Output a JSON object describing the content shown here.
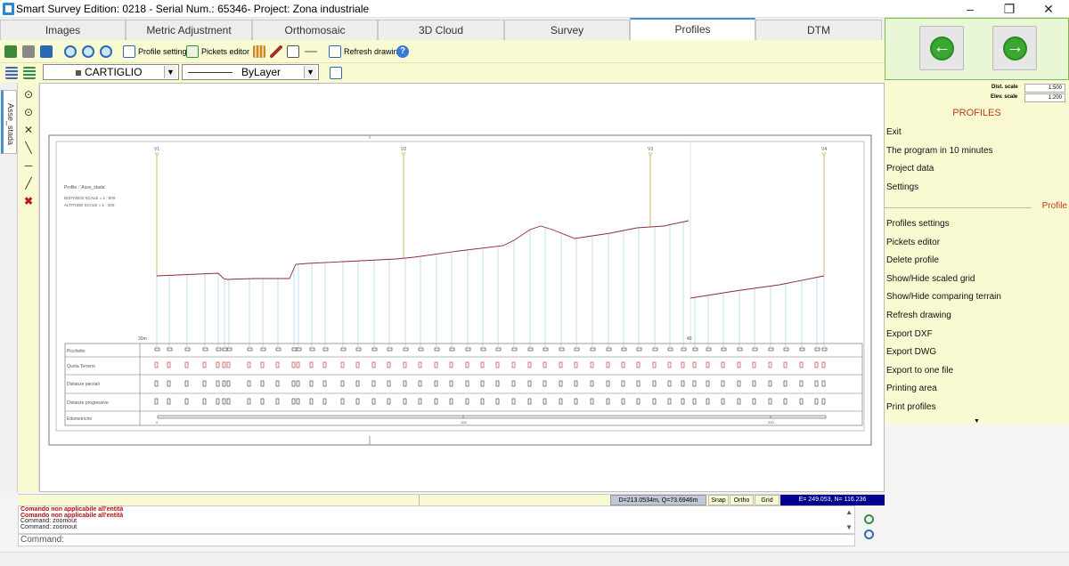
{
  "window": {
    "title": "Smart Survey  Edition: 0218 - Serial Num.: 65346- Project: Zona industriale",
    "min": "–",
    "restore": "❐",
    "close": "✕"
  },
  "tabs": [
    "Images",
    "Metric Adjustment",
    "Orthomosaic",
    "3D Cloud",
    "Survey",
    "Profiles",
    "DTM"
  ],
  "toolbar": {
    "profile_settings": "Profile settings",
    "pickets_editor": "Pickets editor",
    "refresh_drawing": "Refresh drawing",
    "help": "?"
  },
  "layer": {
    "name": "CARTIGLIO",
    "linetype": "ByLayer"
  },
  "left_tab": {
    "label": "Asse_stada"
  },
  "drawing": {
    "profile_name": "Profile : 'Asse_stada'",
    "distance_scale": "DISTANCE SCALE = 1 : 500",
    "altitude_scale": "ALTITUDE SCALE  = 1 : 200",
    "vertices": [
      "V1",
      "V2",
      "V3",
      "V4"
    ],
    "datum_left": "30m",
    "datum_right": "40",
    "rows": [
      "Picchetto",
      "Quota Terreno",
      "Distanze parziali",
      "Distanze progressive",
      "Ettometriche"
    ],
    "hecto_marks": [
      "0",
      "100",
      "200"
    ]
  },
  "status": {
    "coords": "D=213.0534m, Q=73.6946m",
    "snap": "Snap",
    "ortho": "Ortho",
    "grid": "Grid",
    "position": "E=  249.053, N=  116.236"
  },
  "command": {
    "messages": [
      "Comando non applicabile all'entità",
      "Comando non applicabile all'entità",
      "Command: zoomout",
      "Command: zoomout"
    ],
    "prompt": "Command:"
  },
  "scales": {
    "dist_label": "Dist. scale",
    "dist_value": "1:500",
    "elev_label": "Elev. scale",
    "elev_value": "1:200"
  },
  "menu": {
    "header": "PROFILES",
    "items_top": [
      "Exit",
      "The program in 10 minutes",
      "Project data",
      "Settings"
    ],
    "section": "Profile",
    "items_profile": [
      "Profiles settings",
      "Pickets editor",
      "Delete profile",
      "Show/Hide scaled grid",
      "Show/Hide comparing terrain",
      "Refresh drawing",
      "Export DXF",
      "Export DWG",
      "Export to one file",
      "Printing area",
      "Print profiles"
    ],
    "scroll_down": "▼"
  },
  "colors": {
    "menu_accent": "#b84016",
    "nav_green": "#3aa830",
    "terrain": "#8b2a3a",
    "station_line": "#9fd4e8",
    "vertex_line": "#c8a438",
    "status_blue": "#00008b"
  }
}
